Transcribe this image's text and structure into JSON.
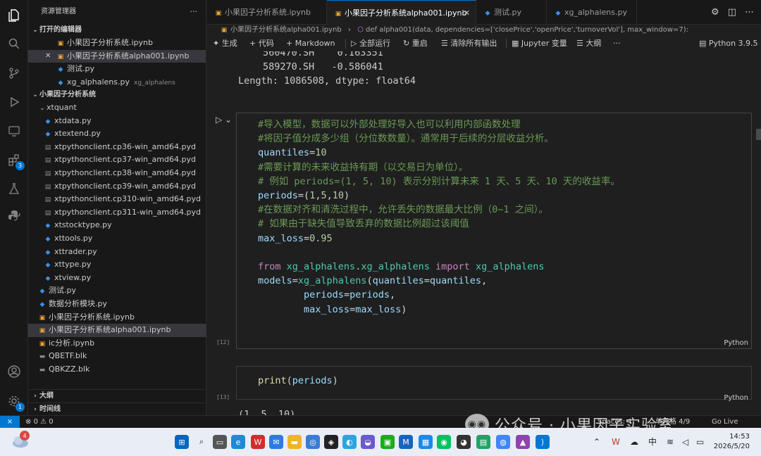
{
  "sidebar": {
    "title": "资源管理器",
    "more": "···",
    "open_editors": {
      "label": "打开的编辑器",
      "items": [
        {
          "name": "小果因子分析系统.ipynb",
          "type": "nb",
          "desc": ""
        },
        {
          "name": "小果因子分析系统alpha001.ipynb",
          "type": "nb",
          "desc": ""
        },
        {
          "name": "测试.py",
          "type": "py",
          "desc": ""
        },
        {
          "name": "xg_alphalens.py",
          "type": "py",
          "desc": "xg_alphalens"
        }
      ]
    },
    "workspace": {
      "label": "小果因子分析系统",
      "folder": "xtquant",
      "folder_items": [
        {
          "name": "xtdata.py",
          "type": "py"
        },
        {
          "name": "xtextend.py",
          "type": "py"
        },
        {
          "name": "xtpythonclient.cp36-win_amd64.pyd",
          "type": "pyd"
        },
        {
          "name": "xtpythonclient.cp37-win_amd64.pyd",
          "type": "pyd"
        },
        {
          "name": "xtpythonclient.cp38-win_amd64.pyd",
          "type": "pyd"
        },
        {
          "name": "xtpythonclient.cp39-win_amd64.pyd",
          "type": "pyd"
        },
        {
          "name": "xtpythonclient.cp310-win_amd64.pyd",
          "type": "pyd"
        },
        {
          "name": "xtpythonclient.cp311-win_amd64.pyd",
          "type": "pyd"
        },
        {
          "name": "xtstocktype.py",
          "type": "py"
        },
        {
          "name": "xttools.py",
          "type": "py"
        },
        {
          "name": "xttrader.py",
          "type": "py"
        },
        {
          "name": "xttype.py",
          "type": "py"
        },
        {
          "name": "xtview.py",
          "type": "py"
        }
      ],
      "root_items": [
        {
          "name": "测试.py",
          "type": "py"
        },
        {
          "name": "数据分析模块.py",
          "type": "py"
        },
        {
          "name": "小果因子分析系统.ipynb",
          "type": "nb"
        },
        {
          "name": "小果因子分析系统alpha001.ipynb",
          "type": "nb"
        },
        {
          "name": "ic分析.ipynb",
          "type": "nb"
        },
        {
          "name": "QBETF.blk",
          "type": "blk"
        },
        {
          "name": "QBKZZ.blk",
          "type": "blk"
        }
      ]
    },
    "outline_label": "大纲",
    "timeline_label": "时间线"
  },
  "tabs": [
    {
      "label": "小果因子分析系统.ipynb"
    },
    {
      "label": "小果因子分析系统alpha001.ipynb"
    },
    {
      "label": "测试.py"
    },
    {
      "label": "xg_alphalens.py"
    }
  ],
  "breadcrumb": {
    "file": "小果因子分析系统alpha001.ipynb",
    "sep": "›",
    "symbol": "def alpha001(data, dependencies=['closePrice','openPrice','turnoverVol'], max_window=7):"
  },
  "toolbar": {
    "generate": "生成",
    "code": "代码",
    "markdown": "Markdown",
    "run_all": "全部运行",
    "restart": "重启",
    "clear_outputs": "清除所有输出",
    "jupyter_vars": "Jupyter 变量",
    "outline": "大纲",
    "more": "···",
    "kernel": "Python 3.9.5"
  },
  "output_top": {
    "rows": [
      "        560470.SH    0.163351",
      "        589270.SH   -0.586041",
      "Length: 1086508, dtype: float64"
    ]
  },
  "cell12": {
    "exec": "[12]",
    "lang": "Python",
    "lines": [
      "#导入模型，数据可以外部处理好导入也可以利用内部函数处理",
      "#将因子值分成多少组（分位数数量）。通常用于后续的分层收益分析。",
      "quantiles=10",
      "#需要计算的未来收益持有期（以交易日为单位）。",
      "# 例如 periods=(1, 5, 10) 表示分别计算未来 1 天、5 天、10 天的收益率。",
      "periods=(1,5,10)",
      "#在数据对齐和清洗过程中，允许丢失的数据最大比例（0~1 之间）。",
      "# 如果由于缺失值导致丢弃的数据比例超过该阈值",
      "max_loss=0.95",
      "",
      "from xg_alphalens.xg_alphalens import xg_alphalens",
      "models=xg_alphalens(quantiles=quantiles,",
      "        periods=periods,",
      "        max_loss=max_loss)"
    ]
  },
  "cell13": {
    "exec": "[13]",
    "lang": "Python",
    "code": "print(periods)",
    "output": "(1, 5, 10)"
  },
  "status": {
    "remote": "⨯",
    "errors": "0",
    "warnings": "0",
    "right_a": "Spaces: 4",
    "right_b": "单元格 4/9",
    "right_c": "Go Live"
  },
  "watermark": {
    "text": "公众号 · 小果因子实验室"
  },
  "taskbar": {
    "weather_badge": "4",
    "ime": "中",
    "time": "14:53",
    "date": "2026/5/20"
  }
}
